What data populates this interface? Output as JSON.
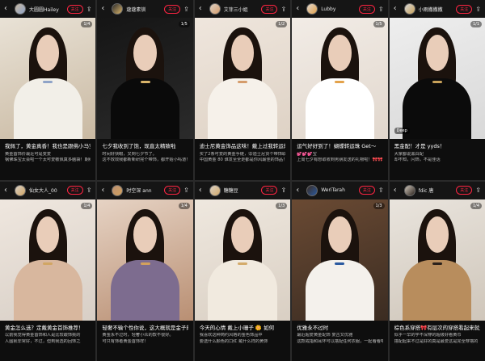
{
  "cards": [
    {
      "author": "大圆圆Hailey",
      "follow_label": "关注",
      "title": "我佩了，黄金真香！我也是跟佛小马宝莉的人啦",
      "body1": "黄金首饰价最近可是变爱",
      "body2": "钢佛珠宝太会啦一个太可爱敬佩真多脑袋！期约我",
      "pager": "1/4",
      "colors": {
        "bg1": "#e9e2d6",
        "bg2": "#c9b9a2",
        "cloth": "#f2efe8",
        "accent": "#8fa3c7"
      }
    },
    {
      "author": "蔻蔻素钏",
      "follow_label": "关注",
      "title": "七夕我收到了饱，现直太精致啦",
      "body1": "时间好快眼，又到七夕节了。",
      "body2": "这不效效我都新新研完个带饰，都开始小吗道！",
      "pager": "1/5",
      "colors": {
        "bg1": "#151515",
        "bg2": "#2b2b2b",
        "cloth": "#0a0a0a",
        "accent": "#d9b46a"
      }
    },
    {
      "author": "艾菲三小姐",
      "follow_label": "关注",
      "title": "迪士尼黄金饰品这味！戴上过我转运爆棚",
      "body1": "买了2条可爱的黄金手链，🐭迪士尼货个带饰取名...",
      "body2": "中国黄金 80 谁发至全走都是你风最佳的饰品！",
      "pager": "1/2",
      "colors": {
        "bg1": "#efe6dd",
        "bg2": "#ded2c5",
        "cloth": "#f6f1ea",
        "accent": "#d59c6b"
      }
    },
    {
      "author": "Lubby",
      "follow_label": "关注",
      "title": "运气好好到了！蝴蝶转运珠 Get～",
      "body1": "💕💕💕宝",
      "body2": "上周七夕有想取收到男朋友送的礼物啦！🎀🎀",
      "pager": "1/5",
      "colors": {
        "bg1": "#f2ece6",
        "bg2": "#e1d7cd",
        "cloth": "#ffffff",
        "accent": "#e3a24b"
      }
    },
    {
      "author": "小雨撒撒撒",
      "follow_label": "关注",
      "title": "黑金配！才是 yyds！",
      "body1": "大家都说黑白配",
      "body2": "却不知，闪饰，不是佳话",
      "pager": "1/1",
      "chip": "Deep",
      "colors": {
        "bg1": "#eeeeee",
        "bg2": "#d8d8d8",
        "cloth": "#0b0b0b",
        "accent": "#c8a25a"
      }
    },
    {
      "author": "仙女大人_00",
      "follow_label": "关注",
      "title": "黄金怎么选？定戴黄金首饰推荐！",
      "body1": "以前我觉得黄金首饰和人是比较跟饰挑的",
      "body2": "人图就非常好，不过，但到我选的回饰之",
      "pager": "1/4",
      "colors": {
        "bg1": "#efe7df",
        "bg2": "#d8cfc6",
        "cloth": "#d8b79e",
        "accent": "#d1a664"
      }
    },
    {
      "author": "时空深 ann",
      "follow_label": "关注",
      "title": "轻奢不输个性你说，这大概就是金子的魅力",
      "body1": "黄金永不过时，轻奢小众的款不很好。",
      "body2": "可只有饰者黄金首饰样！",
      "pager": "1/4",
      "colors": {
        "bg1": "#e6d3c4",
        "bg2": "#b98f73",
        "cloth": "#7d6c8f",
        "accent": "#d3a15c"
      }
    },
    {
      "author": "糖糖豆",
      "follow_label": "关注",
      "title": "今天的心情 戴上小珊子 🌼 如何",
      "body1": "我喜欢这种简约风格的金色饰品中",
      "body2": "要选什么颜色的口红 戴什么样的黄饰",
      "pager": "1/3",
      "colors": {
        "bg1": "#efe8df",
        "bg2": "#d9cfc3",
        "cloth": "#f1eadf",
        "accent": "#d4ab6b"
      }
    },
    {
      "author": "WeriTarah",
      "follow_label": "关注",
      "title": "优雅永不过时",
      "body1": "最近超爱黄金配饰 复古又优雅",
      "body2": "这款戒指和耳环可以搭配任何衣服，一起看看吧",
      "pager": "1/3",
      "colors": {
        "bg1": "#6a4a33",
        "bg2": "#3b2c22",
        "cloth": "#f4f1ec",
        "accent": "#2b5aa0"
      }
    },
    {
      "author": "fdic 唐",
      "follow_label": "关注",
      "title": "棕色系穿搭🎀有层次的穿搭看起来就是酷",
      "body1": "似乎一早的学不深穿的超级好看黄巾",
      "body2": "搭配起来不过是好的真是最爱这是完全穿搭的",
      "pager": "1/4",
      "colors": {
        "bg1": "#e9e4dd",
        "bg2": "#cfc6ba",
        "cloth": "#b88d5d",
        "accent": "#2a211b"
      }
    }
  ],
  "icons": {
    "back": "chevron-left-icon",
    "share": "share-icon"
  }
}
